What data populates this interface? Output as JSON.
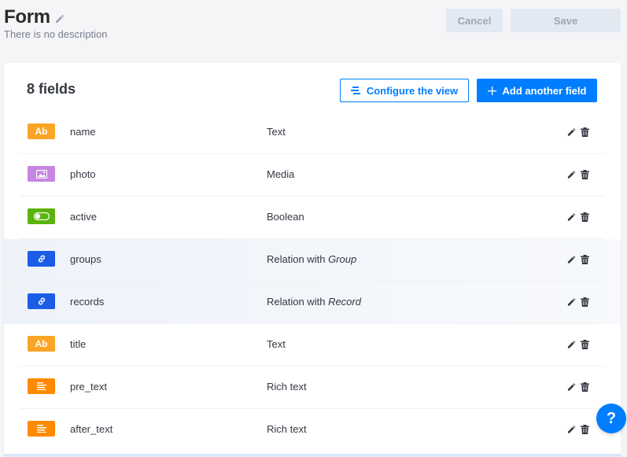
{
  "header": {
    "title": "Form",
    "description": "There is no description",
    "cancel_label": "Cancel",
    "save_label": "Save"
  },
  "list": {
    "count_label": "8 fields",
    "configure_label": "Configure the view",
    "add_label": "Add another field",
    "rows": [
      {
        "name": "name",
        "type": "Text",
        "type_target": "",
        "icon": "text-icon",
        "badge": "Ab",
        "color": "#faa526",
        "highlighted": false
      },
      {
        "name": "photo",
        "type": "Media",
        "type_target": "",
        "icon": "media-icon",
        "badge": "",
        "color": "#c787e1",
        "highlighted": false
      },
      {
        "name": "active",
        "type": "Boolean",
        "type_target": "",
        "icon": "boolean-icon",
        "badge": "",
        "color": "#5bb30e",
        "highlighted": false
      },
      {
        "name": "groups",
        "type": "Relation with",
        "type_target": "Group",
        "icon": "relation-icon",
        "badge": "",
        "color": "#1c5de7",
        "highlighted": true
      },
      {
        "name": "records",
        "type": "Relation with",
        "type_target": "Record",
        "icon": "relation-icon",
        "badge": "",
        "color": "#1c5de7",
        "highlighted": true
      },
      {
        "name": "title",
        "type": "Text",
        "type_target": "",
        "icon": "text-icon",
        "badge": "Ab",
        "color": "#faa526",
        "highlighted": false
      },
      {
        "name": "pre_text",
        "type": "Rich text",
        "type_target": "",
        "icon": "richtext-icon",
        "badge": "",
        "color": "#ff8a00",
        "highlighted": false
      },
      {
        "name": "after_text",
        "type": "Rich text",
        "type_target": "",
        "icon": "richtext-icon",
        "badge": "",
        "color": "#ff8a00",
        "highlighted": false
      }
    ]
  },
  "help": {
    "label": "?"
  },
  "colors": {
    "accent": "#007eff",
    "disabled_bg": "#e3e9f3"
  }
}
